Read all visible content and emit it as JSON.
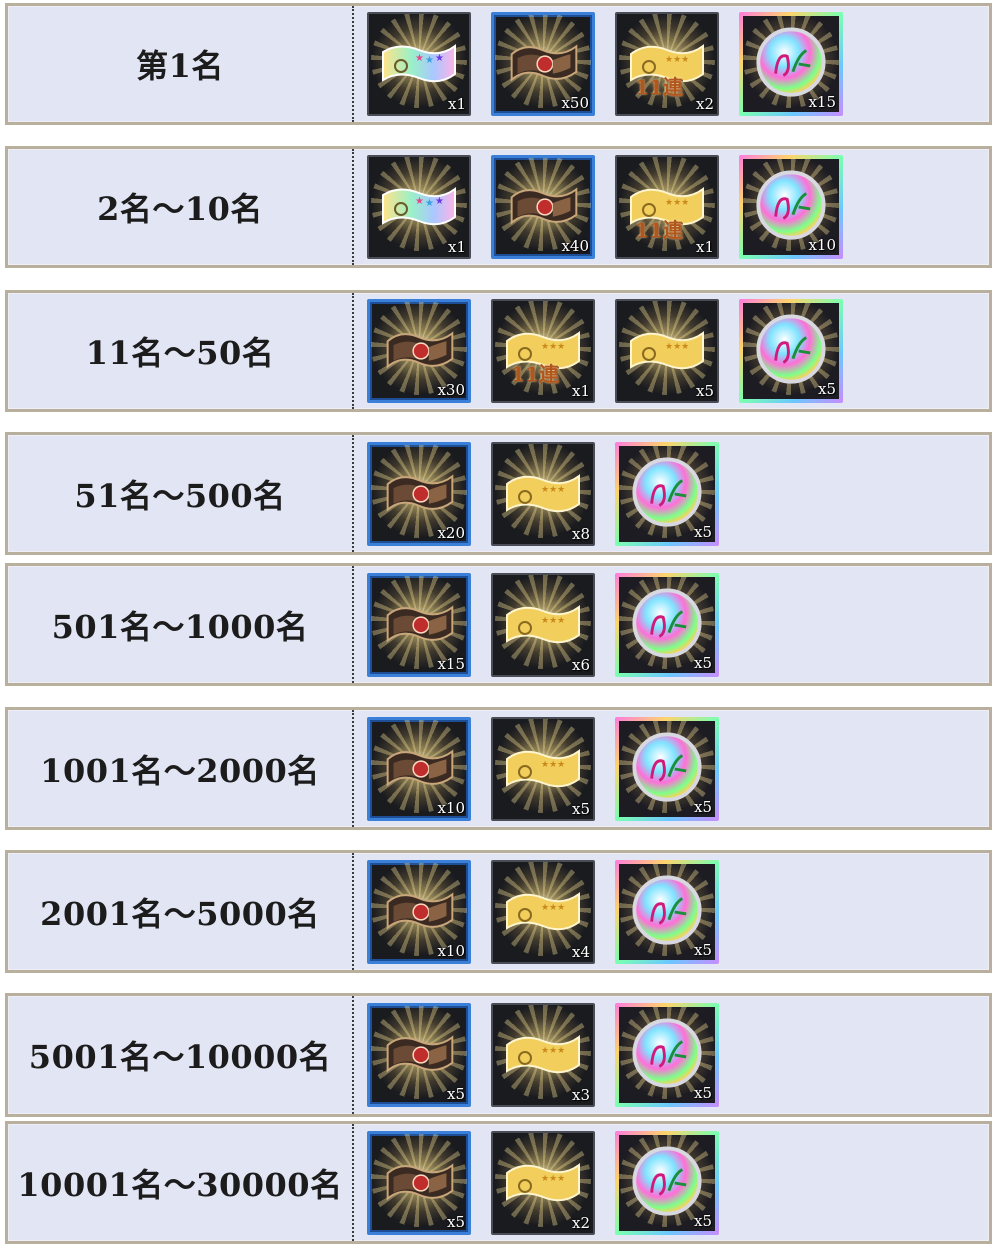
{
  "rewards": [
    {
      "rank": "第1名",
      "items": [
        {
          "type": "rainbow-ticket",
          "frame": "frame-dark",
          "qty": "x1"
        },
        {
          "type": "scroll",
          "frame": "frame-blue",
          "qty": "x50"
        },
        {
          "type": "ticket-11",
          "frame": "frame-dark",
          "qty": "x2",
          "badge": "11連"
        },
        {
          "type": "orb",
          "frame": "frame-rainbow",
          "qty": "x15"
        }
      ]
    },
    {
      "rank": "2名～10名",
      "items": [
        {
          "type": "rainbow-ticket",
          "frame": "frame-dark",
          "qty": "x1"
        },
        {
          "type": "scroll",
          "frame": "frame-blue",
          "qty": "x40"
        },
        {
          "type": "ticket-11",
          "frame": "frame-dark",
          "qty": "x1",
          "badge": "11連"
        },
        {
          "type": "orb",
          "frame": "frame-rainbow",
          "qty": "x10"
        }
      ]
    },
    {
      "rank": "11名～50名",
      "items": [
        {
          "type": "scroll",
          "frame": "frame-blue",
          "qty": "x30"
        },
        {
          "type": "ticket-11",
          "frame": "frame-dark",
          "qty": "x1",
          "badge": "11連"
        },
        {
          "type": "gold-ticket",
          "frame": "frame-dark",
          "qty": "x5"
        },
        {
          "type": "orb",
          "frame": "frame-rainbow",
          "qty": "x5"
        }
      ]
    },
    {
      "rank": "51名～500名",
      "items": [
        {
          "type": "scroll",
          "frame": "frame-blue",
          "qty": "x20"
        },
        {
          "type": "gold-ticket",
          "frame": "frame-dark",
          "qty": "x8"
        },
        {
          "type": "orb",
          "frame": "frame-rainbow",
          "qty": "x5"
        }
      ]
    },
    {
      "rank": "501名～1000名",
      "items": [
        {
          "type": "scroll",
          "frame": "frame-blue",
          "qty": "x15"
        },
        {
          "type": "gold-ticket",
          "frame": "frame-dark",
          "qty": "x6"
        },
        {
          "type": "orb",
          "frame": "frame-rainbow",
          "qty": "x5"
        }
      ]
    },
    {
      "rank": "1001名～2000名",
      "items": [
        {
          "type": "scroll",
          "frame": "frame-blue",
          "qty": "x10"
        },
        {
          "type": "gold-ticket",
          "frame": "frame-dark",
          "qty": "x5"
        },
        {
          "type": "orb",
          "frame": "frame-rainbow",
          "qty": "x5"
        }
      ]
    },
    {
      "rank": "2001名～5000名",
      "items": [
        {
          "type": "scroll",
          "frame": "frame-blue",
          "qty": "x10"
        },
        {
          "type": "gold-ticket",
          "frame": "frame-dark",
          "qty": "x4"
        },
        {
          "type": "orb",
          "frame": "frame-rainbow",
          "qty": "x5"
        }
      ]
    },
    {
      "rank": "5001名～10000名",
      "items": [
        {
          "type": "scroll",
          "frame": "frame-blue",
          "qty": "x5"
        },
        {
          "type": "gold-ticket",
          "frame": "frame-dark",
          "qty": "x3"
        },
        {
          "type": "orb",
          "frame": "frame-rainbow",
          "qty": "x5"
        }
      ]
    },
    {
      "rank": "10001名～30000名",
      "items": [
        {
          "type": "scroll",
          "frame": "frame-blue",
          "qty": "x5"
        },
        {
          "type": "gold-ticket",
          "frame": "frame-dark",
          "qty": "x2"
        },
        {
          "type": "orb",
          "frame": "frame-rainbow",
          "qty": "x5"
        }
      ]
    }
  ],
  "colors": {
    "row_bg": "#e2e5f3",
    "row_border": "#b8b09c",
    "blue_frame": "#3a7fd8"
  }
}
